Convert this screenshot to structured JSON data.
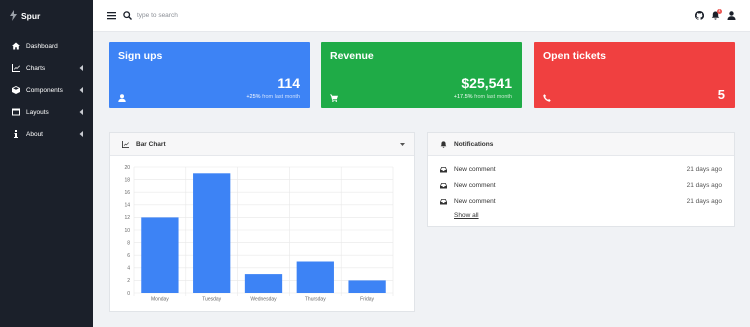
{
  "app": {
    "brand": "Spur"
  },
  "sidebar": {
    "items": [
      {
        "label": "Dashboard",
        "icon": "home-icon",
        "has_submenu": false
      },
      {
        "label": "Charts",
        "icon": "chart-line-icon",
        "has_submenu": true
      },
      {
        "label": "Components",
        "icon": "cube-icon",
        "has_submenu": true
      },
      {
        "label": "Layouts",
        "icon": "window-icon",
        "has_submenu": true
      },
      {
        "label": "About",
        "icon": "info-icon",
        "has_submenu": true
      }
    ]
  },
  "topbar": {
    "search_placeholder": "type to search",
    "notification_count": "4"
  },
  "stats": [
    {
      "title": "Sign ups",
      "value": "114",
      "change": "+25%",
      "suffix": "from last month",
      "icon": "user-icon",
      "color": "#3d83f5"
    },
    {
      "title": "Revenue",
      "value": "$25,541",
      "change": "+17.5%",
      "suffix": "from last month",
      "icon": "cart-icon",
      "color": "#1fab47"
    },
    {
      "title": "Open tickets",
      "value": "5",
      "change": "",
      "suffix": "",
      "icon": "phone-icon",
      "color": "#f04040"
    }
  ],
  "bar_panel": {
    "title": "Bar Chart"
  },
  "chart_data": {
    "type": "bar",
    "title": "",
    "categories": [
      "Monday",
      "Tuesday",
      "Wednesday",
      "Thursday",
      "Friday"
    ],
    "values": [
      12,
      19,
      3,
      5,
      2
    ],
    "ylim": [
      0,
      20
    ],
    "yticks": [
      0,
      2,
      4,
      6,
      8,
      10,
      12,
      14,
      16,
      18,
      20
    ],
    "bar_color": "#3d83f5",
    "grid": true,
    "xlabel": "",
    "ylabel": ""
  },
  "notifications": {
    "title": "Notifications",
    "items": [
      {
        "label": "New comment",
        "time": "21 days ago"
      },
      {
        "label": "New comment",
        "time": "21 days ago"
      },
      {
        "label": "New comment",
        "time": "21 days ago"
      }
    ],
    "show_all": "Show all"
  }
}
